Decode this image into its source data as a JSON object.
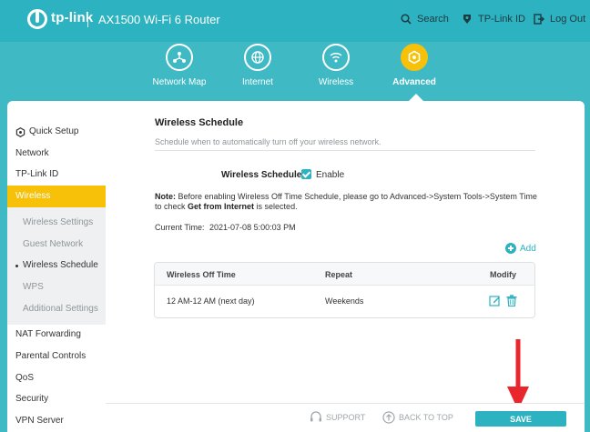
{
  "header": {
    "logo_text": "tp-link",
    "model": "AX1500 Wi-Fi 6 Router",
    "search_label": "Search",
    "tplink_id_label": "TP-Link ID",
    "logout_label": "Log Out"
  },
  "nav": {
    "network_map": "Network Map",
    "internet": "Internet",
    "wireless": "Wireless",
    "advanced": "Advanced"
  },
  "sidebar": {
    "items": [
      {
        "label": "Quick Setup"
      },
      {
        "label": "Network"
      },
      {
        "label": "TP-Link ID"
      },
      {
        "label": "Wireless"
      },
      {
        "label": "Wireless Settings"
      },
      {
        "label": "Guest Network"
      },
      {
        "label": "Wireless Schedule"
      },
      {
        "label": "WPS"
      },
      {
        "label": "Additional Settings"
      },
      {
        "label": "NAT Forwarding"
      },
      {
        "label": "Parental Controls"
      },
      {
        "label": "QoS"
      },
      {
        "label": "Security"
      },
      {
        "label": "VPN Server"
      }
    ]
  },
  "main": {
    "title": "Wireless Schedule",
    "description": "Schedule when to automatically turn off your wireless network.",
    "schedule_label": "Wireless Schedule:",
    "enable_label": "Enable",
    "enable_checked": true,
    "note_prefix": "Note:",
    "note_text": " Before enabling Wireless Off Time Schedule, please go to Advanced->System Tools->System Time to check ",
    "note_bold": "Get from Internet",
    "note_suffix": " is selected.",
    "current_time_label": "Current Time:",
    "current_time_value": "2021-07-08 5:00:03 PM",
    "add_label": "Add",
    "table": {
      "headers": [
        "Wireless Off Time",
        "Repeat",
        "Modify"
      ],
      "rows": [
        {
          "off_time": "12 AM-12 AM (next day)",
          "repeat": "Weekends"
        }
      ]
    }
  },
  "footer": {
    "support_label": "SUPPORT",
    "back_to_top_label": "BACK TO TOP",
    "save_label": "SAVE"
  },
  "colors": {
    "header_bg": "#2cb2c0",
    "accent": "#2cb2c0",
    "active": "#f6c108",
    "arrow": "#e8262b"
  }
}
